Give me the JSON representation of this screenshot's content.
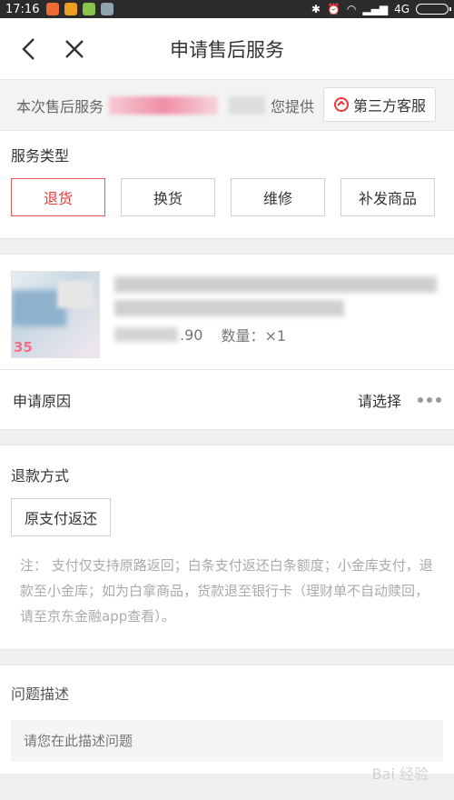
{
  "statusbar": {
    "time": "17:16",
    "network": "4G"
  },
  "nav": {
    "title": "申请售后服务"
  },
  "notice": {
    "prefix": "本次售后服务",
    "suffix": "您提供",
    "cs_label": "第三方客服"
  },
  "service": {
    "title": "服务类型",
    "types": [
      {
        "label": "退货",
        "active": true
      },
      {
        "label": "换货"
      },
      {
        "label": "维修"
      },
      {
        "label": "补发商品"
      }
    ]
  },
  "product": {
    "thumb_tag": "35",
    "price_tail": ".90",
    "qty_label": "数量：×1"
  },
  "reason": {
    "label": "申请原因",
    "value": "请选择"
  },
  "refund": {
    "title": "退款方式",
    "method": "原支付返还",
    "note": "注：  支付仅支持原路返回；白条支付返还白条额度；小金库支付，退款至小金库；如为白拿商品，货款退至银行卡（理财单不自动赎回，请至京东金融app查看）。"
  },
  "problem": {
    "title": "问题描述",
    "placeholder": "请您在此描述问题"
  },
  "watermark": "Bai 经验",
  "colors": {
    "accent": "#e4393c",
    "statusbar": "#2b2b2b"
  }
}
